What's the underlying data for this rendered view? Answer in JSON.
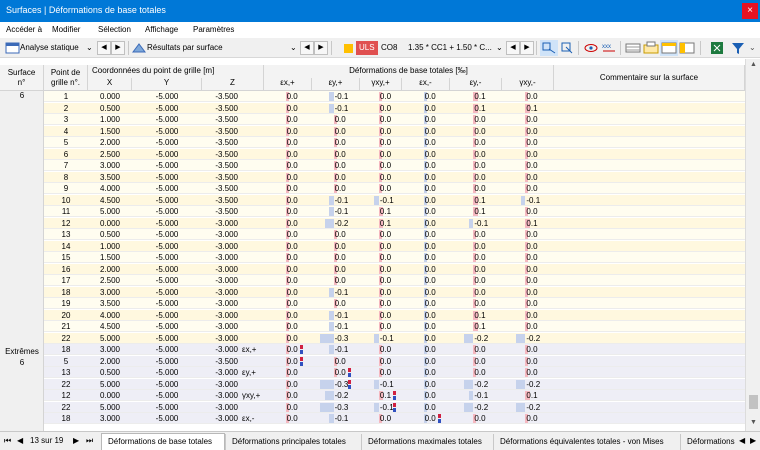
{
  "window": {
    "title": "Surfaces | Déformations de base totales",
    "close": "×"
  },
  "menu": [
    "Accéder à",
    "Modifier",
    "Sélection",
    "Affichage",
    "Paramètres"
  ],
  "toolbar": {
    "analysis": "Analyse statique",
    "results": "Résultats par surface",
    "uls": "ULS",
    "combo": "CO8",
    "combo_expr": "1.35 * CC1 + 1.50 * C..."
  },
  "headers": {
    "surface": [
      "Surface",
      "n°"
    ],
    "point": [
      "Point de",
      "grille n°."
    ],
    "coords_title": "Coordonnées du point de grille [m]",
    "x": "X",
    "y": "Y",
    "z": "Z",
    "strain_title": "Déformations de base totales [‰]",
    "strains": [
      "εx,+",
      "εy,+",
      "γxy,+",
      "εx,-",
      "εy,-",
      "γxy,-"
    ],
    "comment": "Commentaire sur la surface"
  },
  "left_labels": {
    "surface_no": "6",
    "extremes": "Extrêmes",
    "extremes_no": "6"
  },
  "rows": [
    {
      "p": "1",
      "x": "0.000",
      "y": "-5.000",
      "z": "-3.500",
      "v": [
        "0.0",
        "-0.1",
        "0.0",
        "0.0",
        "0.1",
        "0.0"
      ]
    },
    {
      "p": "2",
      "x": "0.500",
      "y": "-5.000",
      "z": "-3.500",
      "v": [
        "0.0",
        "-0.1",
        "0.0",
        "0.0",
        "0.1",
        "0.1"
      ]
    },
    {
      "p": "3",
      "x": "1.000",
      "y": "-5.000",
      "z": "-3.500",
      "v": [
        "0.0",
        "0.0",
        "0.0",
        "0.0",
        "0.0",
        "0.0"
      ]
    },
    {
      "p": "4",
      "x": "1.500",
      "y": "-5.000",
      "z": "-3.500",
      "v": [
        "0.0",
        "0.0",
        "0.0",
        "0.0",
        "0.0",
        "0.0"
      ]
    },
    {
      "p": "5",
      "x": "2.000",
      "y": "-5.000",
      "z": "-3.500",
      "v": [
        "0.0",
        "0.0",
        "0.0",
        "0.0",
        "0.0",
        "0.0"
      ]
    },
    {
      "p": "6",
      "x": "2.500",
      "y": "-5.000",
      "z": "-3.500",
      "v": [
        "0.0",
        "0.0",
        "0.0",
        "0.0",
        "0.0",
        "0.0"
      ]
    },
    {
      "p": "7",
      "x": "3.000",
      "y": "-5.000",
      "z": "-3.500",
      "v": [
        "0.0",
        "0.0",
        "0.0",
        "0.0",
        "0.0",
        "0.0"
      ]
    },
    {
      "p": "8",
      "x": "3.500",
      "y": "-5.000",
      "z": "-3.500",
      "v": [
        "0.0",
        "0.0",
        "0.0",
        "0.0",
        "0.0",
        "0.0"
      ]
    },
    {
      "p": "9",
      "x": "4.000",
      "y": "-5.000",
      "z": "-3.500",
      "v": [
        "0.0",
        "0.0",
        "0.0",
        "0.0",
        "0.0",
        "0.0"
      ]
    },
    {
      "p": "10",
      "x": "4.500",
      "y": "-5.000",
      "z": "-3.500",
      "v": [
        "0.0",
        "-0.1",
        "-0.1",
        "0.0",
        "0.1",
        "-0.1"
      ]
    },
    {
      "p": "11",
      "x": "5.000",
      "y": "-5.000",
      "z": "-3.500",
      "v": [
        "0.0",
        "-0.1",
        "0.1",
        "0.0",
        "0.1",
        "0.0"
      ]
    },
    {
      "p": "12",
      "x": "0.000",
      "y": "-5.000",
      "z": "-3.000",
      "v": [
        "0.0",
        "-0.2",
        "0.1",
        "0.0",
        "-0.1",
        "0.1"
      ]
    },
    {
      "p": "13",
      "x": "0.500",
      "y": "-5.000",
      "z": "-3.000",
      "v": [
        "0.0",
        "0.0",
        "0.0",
        "0.0",
        "0.0",
        "0.0"
      ]
    },
    {
      "p": "14",
      "x": "1.000",
      "y": "-5.000",
      "z": "-3.000",
      "v": [
        "0.0",
        "0.0",
        "0.0",
        "0.0",
        "0.0",
        "0.0"
      ]
    },
    {
      "p": "15",
      "x": "1.500",
      "y": "-5.000",
      "z": "-3.000",
      "v": [
        "0.0",
        "0.0",
        "0.0",
        "0.0",
        "0.0",
        "0.0"
      ]
    },
    {
      "p": "16",
      "x": "2.000",
      "y": "-5.000",
      "z": "-3.000",
      "v": [
        "0.0",
        "0.0",
        "0.0",
        "0.0",
        "0.0",
        "0.0"
      ]
    },
    {
      "p": "17",
      "x": "2.500",
      "y": "-5.000",
      "z": "-3.000",
      "v": [
        "0.0",
        "0.0",
        "0.0",
        "0.0",
        "0.0",
        "0.0"
      ]
    },
    {
      "p": "18",
      "x": "3.000",
      "y": "-5.000",
      "z": "-3.000",
      "v": [
        "0.0",
        "-0.1",
        "0.0",
        "0.0",
        "0.0",
        "0.0"
      ]
    },
    {
      "p": "19",
      "x": "3.500",
      "y": "-5.000",
      "z": "-3.000",
      "v": [
        "0.0",
        "0.0",
        "0.0",
        "0.0",
        "0.0",
        "0.0"
      ]
    },
    {
      "p": "20",
      "x": "4.000",
      "y": "-5.000",
      "z": "-3.000",
      "v": [
        "0.0",
        "-0.1",
        "0.0",
        "0.0",
        "0.1",
        "0.0"
      ]
    },
    {
      "p": "21",
      "x": "4.500",
      "y": "-5.000",
      "z": "-3.000",
      "v": [
        "0.0",
        "-0.1",
        "0.0",
        "0.0",
        "0.1",
        "0.0"
      ]
    },
    {
      "p": "22",
      "x": "5.000",
      "y": "-5.000",
      "z": "-3.000",
      "v": [
        "0.0",
        "-0.3",
        "-0.1",
        "0.0",
        "-0.2",
        "-0.2"
      ]
    }
  ],
  "extremes": [
    {
      "p": "18",
      "x": "3.000",
      "y": "-5.000",
      "z": "-3.000",
      "type": "εx,+",
      "v": [
        "0.0",
        "-0.1",
        "0.0",
        "0.0",
        "0.0",
        "0.0"
      ]
    },
    {
      "p": "5",
      "x": "2.000",
      "y": "-5.000",
      "z": "-3.500",
      "type": "",
      "v": [
        "0.0",
        "0.0",
        "0.0",
        "0.0",
        "0.0",
        "0.0"
      ]
    },
    {
      "p": "13",
      "x": "0.500",
      "y": "-5.000",
      "z": "-3.000",
      "type": "εy,+",
      "v": [
        "0.0",
        "0.0",
        "0.0",
        "0.0",
        "0.0",
        "0.0"
      ]
    },
    {
      "p": "22",
      "x": "5.000",
      "y": "-5.000",
      "z": "-3.000",
      "type": "",
      "v": [
        "0.0",
        "-0.3",
        "-0.1",
        "0.0",
        "-0.2",
        "-0.2"
      ]
    },
    {
      "p": "12",
      "x": "0.000",
      "y": "-5.000",
      "z": "-3.000",
      "type": "γxy,+",
      "v": [
        "0.0",
        "-0.2",
        "0.1",
        "0.0",
        "-0.1",
        "0.1"
      ]
    },
    {
      "p": "22",
      "x": "5.000",
      "y": "-5.000",
      "z": "-3.000",
      "type": "",
      "v": [
        "0.0",
        "-0.3",
        "-0.1",
        "0.0",
        "-0.2",
        "-0.2"
      ]
    },
    {
      "p": "18",
      "x": "3.000",
      "y": "-5.000",
      "z": "-3.000",
      "type": "εx,-",
      "v": [
        "0.0",
        "-0.1",
        "0.0",
        "0.0",
        "0.0",
        "0.0"
      ]
    }
  ],
  "pager": {
    "first": "⏮",
    "prev": "◀",
    "page": "13 sur 19",
    "next": "▶",
    "last": "⏭"
  },
  "tabs": [
    "Déformations de base totales",
    "Déformations principales totales",
    "Déformations maximales totales",
    "Déformations équivalentes totales - von Mises",
    "Déformations"
  ],
  "colors": {
    "pos": "#f5b8c0",
    "neg": "#c6d2ec",
    "accent": "#0078d7",
    "uls": "#e05050",
    "cc": "#ffc000"
  }
}
